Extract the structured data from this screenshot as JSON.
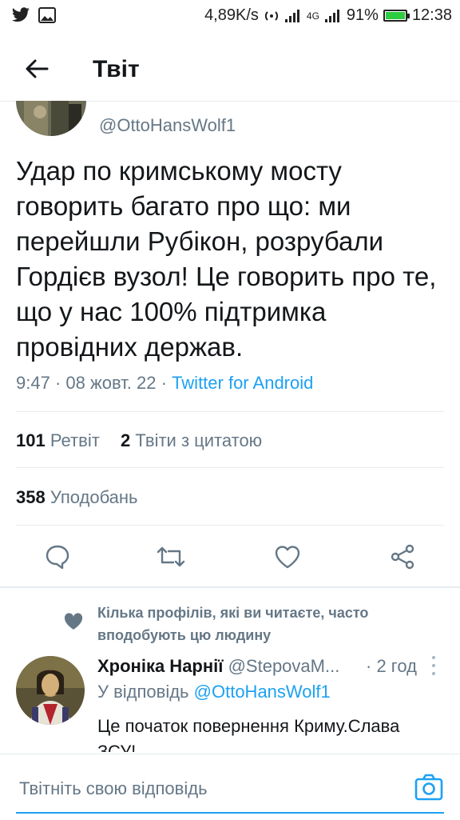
{
  "status_bar": {
    "speed": "4,89K/s",
    "network": "4G",
    "battery_percent": "91%",
    "battery_level": 0.91,
    "time": "12:38"
  },
  "header": {
    "title": "Твіт"
  },
  "tweet": {
    "handle": "@OttoHansWolf1",
    "text": "Удар по кримському мосту говорить багато про що: ми перейшли Рубікон, розрубали Гордієв вузол! Це говорить про те, що у нас 100% підтримка провідних держав.",
    "time": "9:47",
    "date": "08 жовт. 22",
    "source": "Twitter for Android",
    "retweets_count": "101",
    "retweets_label": "Ретвіт",
    "quotes_count": "2",
    "quotes_label": "Твіти з цитатою",
    "likes_count": "358",
    "likes_label": "Уподобань"
  },
  "social_context": "Кілька профілів, які ви читаєте, часто вподобують цю людину",
  "reply": {
    "name": "Хроніка Нарнії",
    "handle": "@StepovaM...",
    "time": "· 2 год",
    "replying_label": "У відповідь",
    "replying_to": "@OttoHansWolf1",
    "text": "Це початок повернення Криму.Слава ЗСУ!"
  },
  "composer": {
    "placeholder": "Твітніть свою відповідь"
  },
  "colors": {
    "accent": "#1da1f2",
    "secondary_text": "#657786",
    "primary_text": "#14171a"
  }
}
